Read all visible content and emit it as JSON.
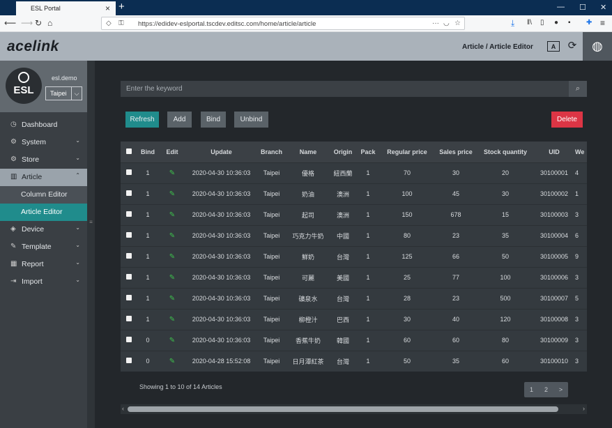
{
  "browser": {
    "tab_title": "ESL Portal",
    "tab_close": "×",
    "new_tab": "+",
    "url": "https://edidev-eslportal.tscdev.editsc.com/home/article/article",
    "win_min": "—",
    "win_max": "☐",
    "win_close": "✕"
  },
  "header": {
    "logo": "acelink",
    "breadcrumb": "Article / Article Editor"
  },
  "user": {
    "avatar_text": "ESL",
    "username": "esl.demo",
    "branch_selected": "Taipei"
  },
  "sidebar": {
    "items": [
      {
        "label": "Dashboard",
        "icon": "dashboard-icon",
        "glyph": "◷"
      },
      {
        "label": "System",
        "icon": "gear-icon",
        "glyph": "⚙"
      },
      {
        "label": "Store",
        "icon": "store-icon",
        "glyph": "⚙"
      },
      {
        "label": "Article",
        "icon": "article-icon",
        "glyph": "▥"
      },
      {
        "label": "Column Editor"
      },
      {
        "label": "Article Editor"
      },
      {
        "label": "Device",
        "icon": "tag-icon",
        "glyph": "◈"
      },
      {
        "label": "Template",
        "icon": "pencil-icon",
        "glyph": "✎"
      },
      {
        "label": "Report",
        "icon": "chart-icon",
        "glyph": "▦"
      },
      {
        "label": "Import",
        "icon": "import-icon",
        "glyph": "⇥"
      }
    ]
  },
  "search": {
    "placeholder": "Enter the keyword"
  },
  "toolbar": {
    "refresh": "Refresh",
    "add": "Add",
    "bind": "Bind",
    "unbind": "Unbind",
    "delete": "Delete"
  },
  "colors": {
    "refresh_bg": "#208c8c",
    "delete_bg": "#dc3545",
    "button_bg": "#5a6268"
  },
  "table": {
    "columns": [
      "",
      "Bind",
      "Edit",
      "Update",
      "Branch",
      "Name",
      "Origin",
      "Pack",
      "Regular price",
      "Sales price",
      "Stock quantity",
      "UID",
      "We"
    ],
    "rows": [
      [
        "1",
        "2020-04-30 10:36:03",
        "Taipei",
        "優格",
        "紐西蘭",
        "1",
        "70",
        "30",
        "20",
        "30100001",
        "4"
      ],
      [
        "1",
        "2020-04-30 10:36:03",
        "Taipei",
        "奶油",
        "澳洲",
        "1",
        "100",
        "45",
        "30",
        "30100002",
        "1"
      ],
      [
        "1",
        "2020-04-30 10:36:03",
        "Taipei",
        "起司",
        "澳洲",
        "1",
        "150",
        "678",
        "15",
        "30100003",
        "3"
      ],
      [
        "1",
        "2020-04-30 10:36:03",
        "Taipei",
        "巧克力牛奶",
        "中國",
        "1",
        "80",
        "23",
        "35",
        "30100004",
        "6"
      ],
      [
        "1",
        "2020-04-30 10:36:03",
        "Taipei",
        "鮮奶",
        "台灣",
        "1",
        "125",
        "66",
        "50",
        "30100005",
        "9"
      ],
      [
        "1",
        "2020-04-30 10:36:03",
        "Taipei",
        "可麗",
        "美國",
        "1",
        "25",
        "77",
        "100",
        "30100006",
        "3"
      ],
      [
        "1",
        "2020-04-30 10:36:03",
        "Taipei",
        "礦泉水",
        "台灣",
        "1",
        "28",
        "23",
        "500",
        "30100007",
        "5"
      ],
      [
        "1",
        "2020-04-30 10:36:03",
        "Taipei",
        "柳橙汁",
        "巴西",
        "1",
        "30",
        "40",
        "120",
        "30100008",
        "3"
      ],
      [
        "0",
        "2020-04-30 10:36:03",
        "Taipei",
        "香蕉牛奶",
        "韓國",
        "1",
        "60",
        "60",
        "80",
        "30100009",
        "3"
      ],
      [
        "0",
        "2020-04-28 15:52:08",
        "Taipei",
        "日月潭紅茶",
        "台灣",
        "1",
        "50",
        "35",
        "60",
        "30100010",
        "3"
      ]
    ]
  },
  "footer": {
    "showing": "Showing 1 to 10 of 14 Articles",
    "pages": [
      "1",
      "2",
      ">"
    ]
  }
}
